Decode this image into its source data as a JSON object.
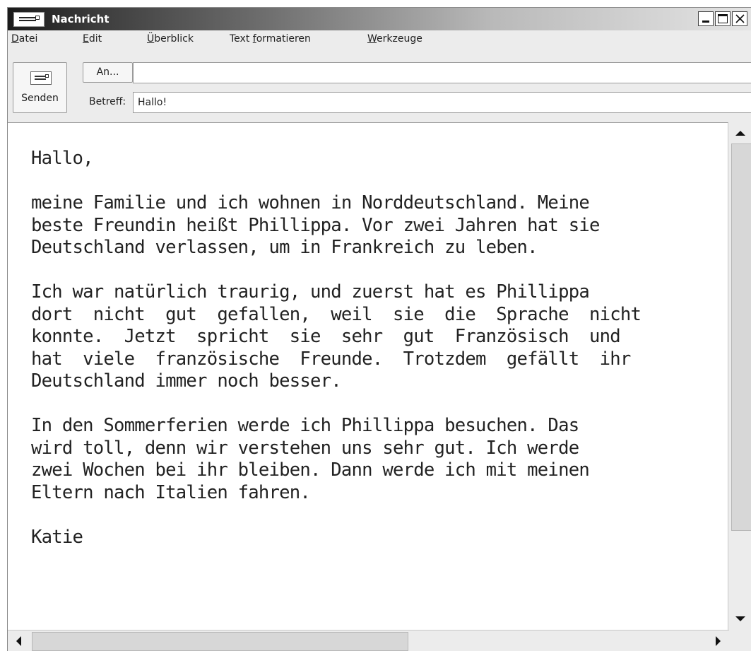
{
  "window": {
    "title": "Nachricht",
    "icon": "envelope-icon",
    "controls": [
      "minimize-icon",
      "maximize-icon",
      "close-icon"
    ]
  },
  "menu": {
    "items": [
      {
        "label": "Datei",
        "mnemonic": "D"
      },
      {
        "label": "Edit",
        "mnemonic": "E"
      },
      {
        "label": "Überblick",
        "mnemonic": "Ü"
      },
      {
        "label": "Text formatieren",
        "mnemonic": "f"
      },
      {
        "label": "Werkzeuge",
        "mnemonic": "W"
      }
    ]
  },
  "toolbar": {
    "send_label": "Senden",
    "send_icon": "envelope-icon",
    "to_button": "An...",
    "to_value": "",
    "subject_label": "Betreff:",
    "subject_value": "Hallo!"
  },
  "message": {
    "body": "Hallo,\n\nmeine Familie und ich wohnen in Norddeutschland. Meine\nbeste Freundin heißt Phillippa. Vor zwei Jahren hat sie\nDeutschland verlassen, um in Frankreich zu leben.\n\nIch war natürlich traurig, und zuerst hat es Phillippa\ndort  nicht  gut  gefallen,  weil  sie  die  Sprache  nicht\nkonnte.  Jetzt  spricht  sie  sehr  gut  Französisch  und\nhat  viele  französische  Freunde.  Trotzdem  gefällt  ihr\nDeutschland immer noch besser.\n\nIn den Sommerferien werde ich Phillippa besuchen. Das\nwird toll, denn wir verstehen uns sehr gut. Ich werde\nzwei Wochen bei ihr bleiben. Dann werde ich mit meinen\nEltern nach Italien fahren.\n\nKatie"
  },
  "scrollbars": {
    "vertical_position": 0.0,
    "horizontal_position": 0.0
  }
}
